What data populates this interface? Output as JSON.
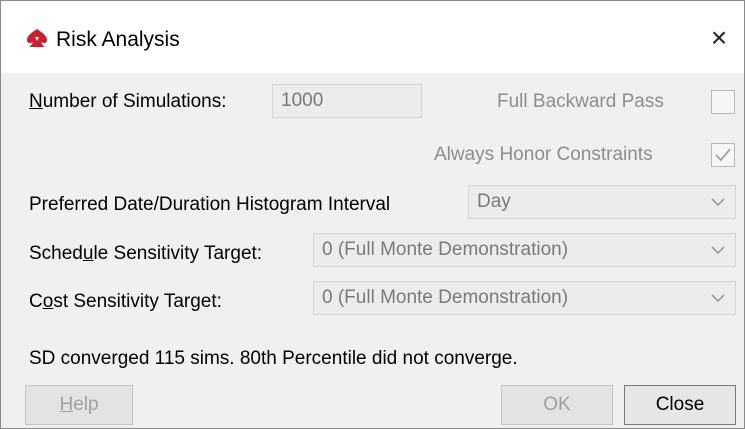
{
  "window": {
    "title": "Risk Analysis",
    "close_glyph": "×",
    "app_icon": "red-spade-logo-icon"
  },
  "form": {
    "num_sims": {
      "label_first": "N",
      "label_rest": "umber of Simulations:",
      "value": "1000"
    },
    "full_backward_pass": {
      "label": "Full Backward Pass",
      "checked": false,
      "enabled": false
    },
    "always_honor_constraints": {
      "label": "Always Honor Constraints",
      "checked": true,
      "enabled": false
    },
    "histogram_interval": {
      "label": "Preferred Date/Duration Histogram Interval",
      "value": "Day"
    },
    "schedule_target": {
      "label_pre": "Sched",
      "label_u": "u",
      "label_post": "le Sensitivity Target:",
      "value": "0 (Full Monte Demonstration)"
    },
    "cost_target": {
      "label_pre": "C",
      "label_u": "o",
      "label_post": "st Sensitivity Target:",
      "value": "0 (Full Monte Demonstration)"
    }
  },
  "status": "SD converged 115 sims. 80th Percentile did not converge.",
  "buttons": {
    "help": {
      "u": "H",
      "rest": "elp"
    },
    "ok": "OK",
    "close": "Close"
  },
  "colors": {
    "brand": "#cc1f2d",
    "disabled_text": "#8d8d8d"
  }
}
